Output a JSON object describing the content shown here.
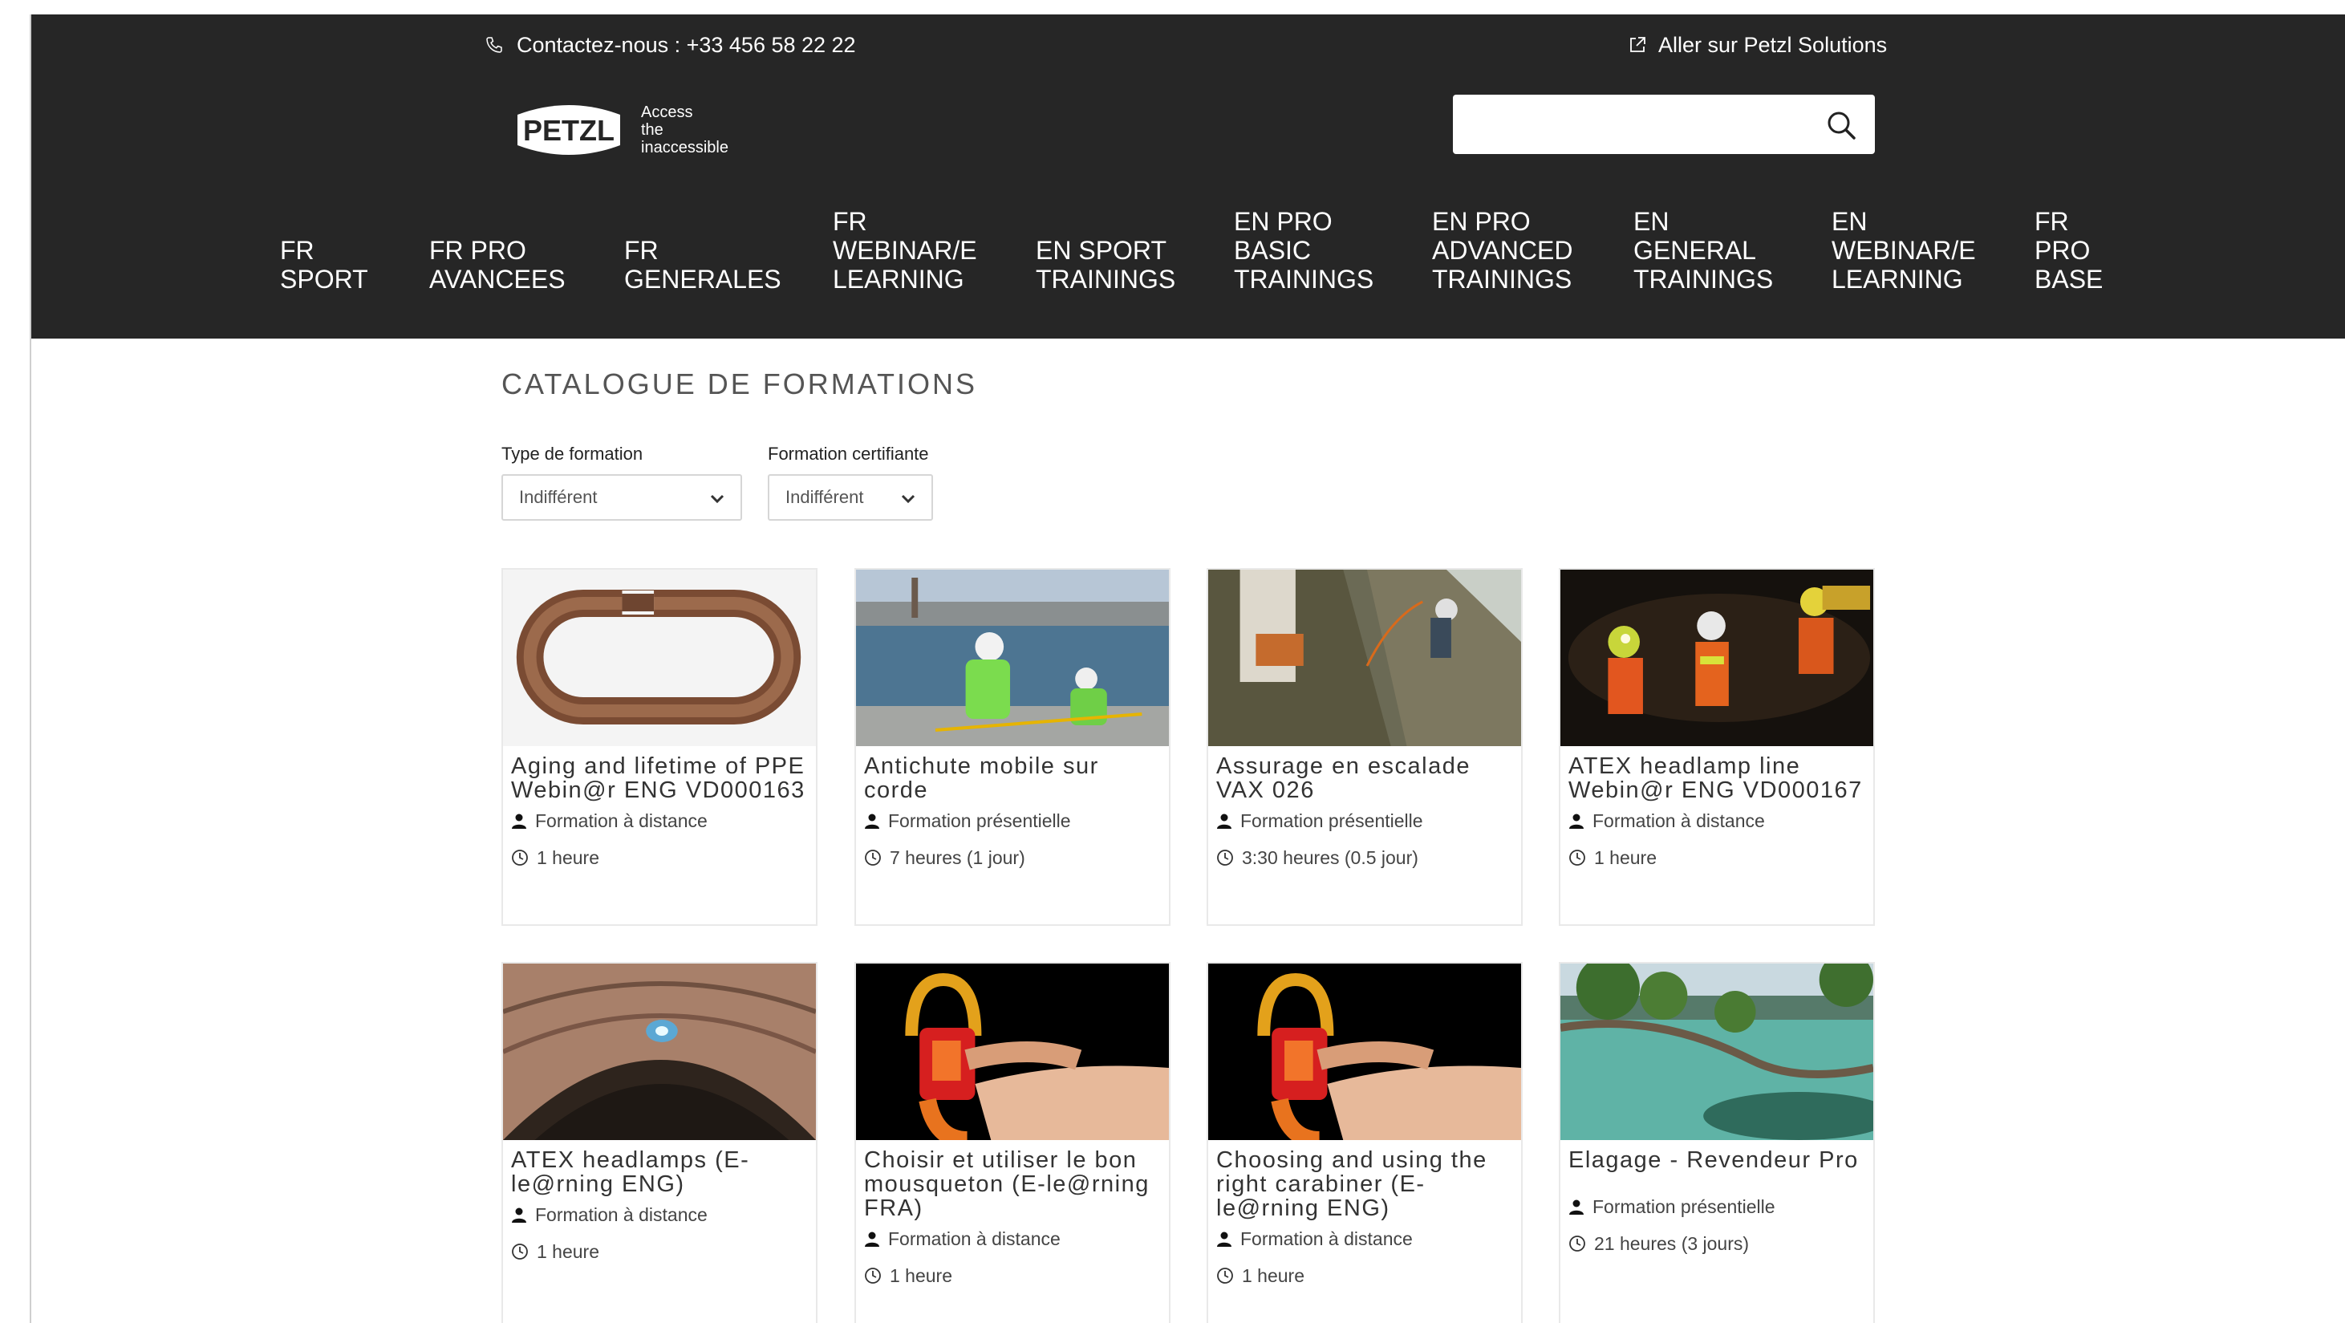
{
  "topbar": {
    "contact": "Contactez-nous : +33 456 58 22 22",
    "external_link": "Aller sur Petzl Solutions"
  },
  "brand": {
    "name": "PETZL",
    "tagline": [
      "Access",
      "the",
      "inaccessible"
    ]
  },
  "search": {
    "value": "",
    "placeholder": ""
  },
  "nav": [
    "FR\nSPORT",
    "FR PRO\nAVANCEES",
    "FR\nGENERALES",
    "FR\nWEBINAR/E\nLEARNING",
    "EN SPORT\nTRAININGS",
    "EN PRO\nBASIC\nTRAININGS",
    "EN PRO\nADVANCED\nTRAININGS",
    "EN\nGENERAL\nTRAININGS",
    "EN\nWEBINAR/E\nLEARNING",
    "FR\nPRO\nBASE"
  ],
  "page_title": "CATALOGUE DE FORMATIONS",
  "filters": [
    {
      "label": "Type de formation",
      "selected": "Indifférent"
    },
    {
      "label": "Formation certifiante",
      "selected": "Indifférent"
    }
  ],
  "cards": [
    {
      "title": "Aging and lifetime of PPE Webin@r ENG VD000163",
      "type": "Formation à distance",
      "duration": "1 heure"
    },
    {
      "title": "Antichute mobile sur corde",
      "type": "Formation présentielle",
      "duration": "7 heures (1 jour)"
    },
    {
      "title": "Assurage en escalade VAX 026",
      "type": "Formation présentielle",
      "duration": "3:30 heures (0.5 jour)"
    },
    {
      "title": "ATEX headlamp line Webin@r ENG VD000167",
      "type": "Formation à distance",
      "duration": "1 heure"
    },
    {
      "title": "ATEX headlamps (E-le@rning ENG)",
      "type": "Formation à distance",
      "duration": "1 heure"
    },
    {
      "title": "Choisir et utiliser le bon mousqueton (E-le@rning FRA)",
      "type": "Formation à distance",
      "duration": "1 heure"
    },
    {
      "title": "Choosing and using the right carabiner (E-le@rning ENG)",
      "type": "Formation à distance",
      "duration": "1 heure"
    },
    {
      "title": "Elagage - Revendeur Pro",
      "type": "Formation présentielle",
      "duration": "21 heures (3 jours)"
    }
  ]
}
